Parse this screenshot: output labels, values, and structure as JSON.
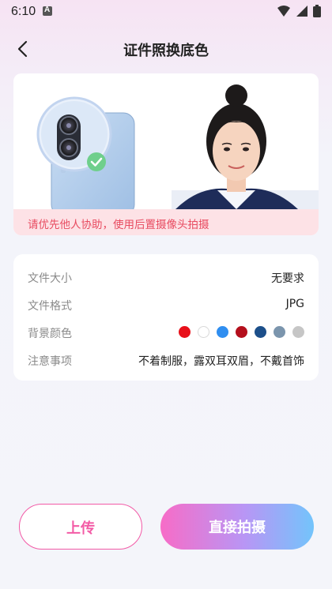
{
  "status": {
    "time": "6:10"
  },
  "header": {
    "title": "证件照换底色"
  },
  "hero": {
    "tip": "请优先他人协助，使用后置摄像头拍摄"
  },
  "info": {
    "rows": [
      {
        "key": "文件大小",
        "value": "无要求"
      },
      {
        "key": "文件格式",
        "value": "JPG"
      },
      {
        "key": "背景颜色",
        "value": ""
      },
      {
        "key": "注意事项",
        "value": "不着制服，露双耳双眉，不戴首饰"
      }
    ],
    "colors": [
      "#e8101a",
      "#ffffff",
      "#2f8ef0",
      "#b40f1c",
      "#1c4f8a",
      "#7b95ad",
      "#c6c6c6"
    ]
  },
  "actions": {
    "upload": "上传",
    "shoot": "直接拍摄"
  },
  "icons": [
    "notification-icon",
    "wifi-icon",
    "signal-icon",
    "battery-icon",
    "back-arrow-icon",
    "check-icon"
  ]
}
